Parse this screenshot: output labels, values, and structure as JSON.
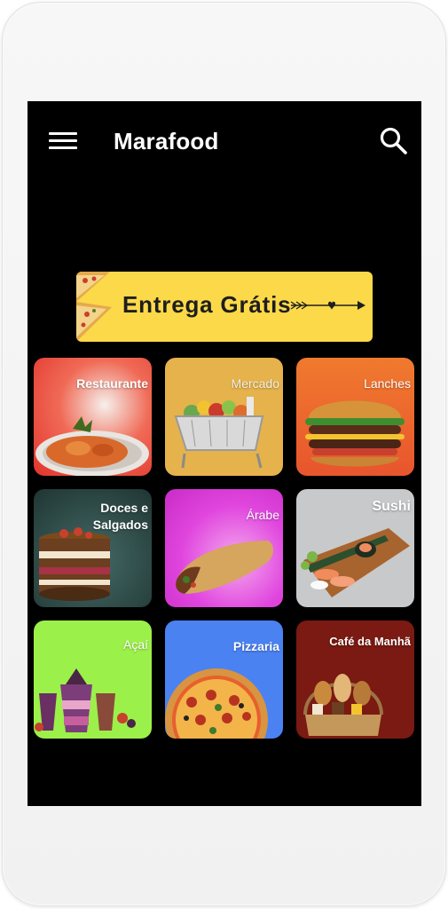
{
  "app": {
    "title": "Marafood"
  },
  "banner": {
    "text": "Entrega Grátis"
  },
  "categories": [
    {
      "label": "Restaurante"
    },
    {
      "label": "Mercado"
    },
    {
      "label": "Lanches"
    },
    {
      "label": "Doces e Salgados"
    },
    {
      "label": "Árabe"
    },
    {
      "label": "Sushi"
    },
    {
      "label": "Açaí"
    },
    {
      "label": "Pizzaria"
    },
    {
      "label": "Café da Manhã"
    }
  ]
}
